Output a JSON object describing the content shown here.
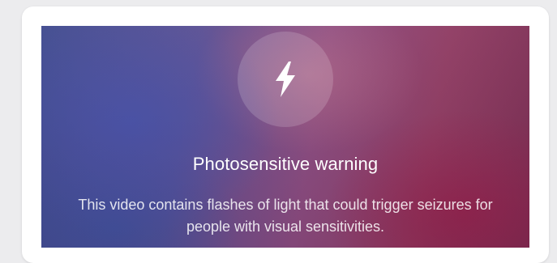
{
  "warning": {
    "icon": "lightning-bolt-icon",
    "title": "Photosensitive warning",
    "body": "This video contains flashes of light that could trigger seizures for people with visual sensitivities."
  },
  "colors": {
    "page_background": "#ececee",
    "card_background": "#ffffff",
    "panel_blue": "#3f4a8f",
    "panel_magenta": "#8f3b62",
    "text": "#ffffff"
  }
}
